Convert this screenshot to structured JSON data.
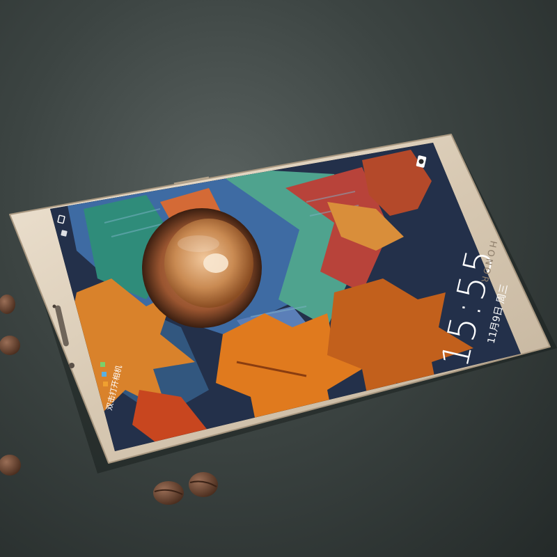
{
  "phone": {
    "brand": "HONOR",
    "body_color": "#d9cbb6"
  },
  "lock_screen": {
    "time": "15:55",
    "date": "11月9日 周三",
    "hint": "双击打开相机"
  },
  "icons": [
    "camera-icon",
    "notification-icon",
    "app-shortcut-icon"
  ],
  "scene_objects": [
    "phone",
    "coffee-bean",
    "leather-surface"
  ]
}
